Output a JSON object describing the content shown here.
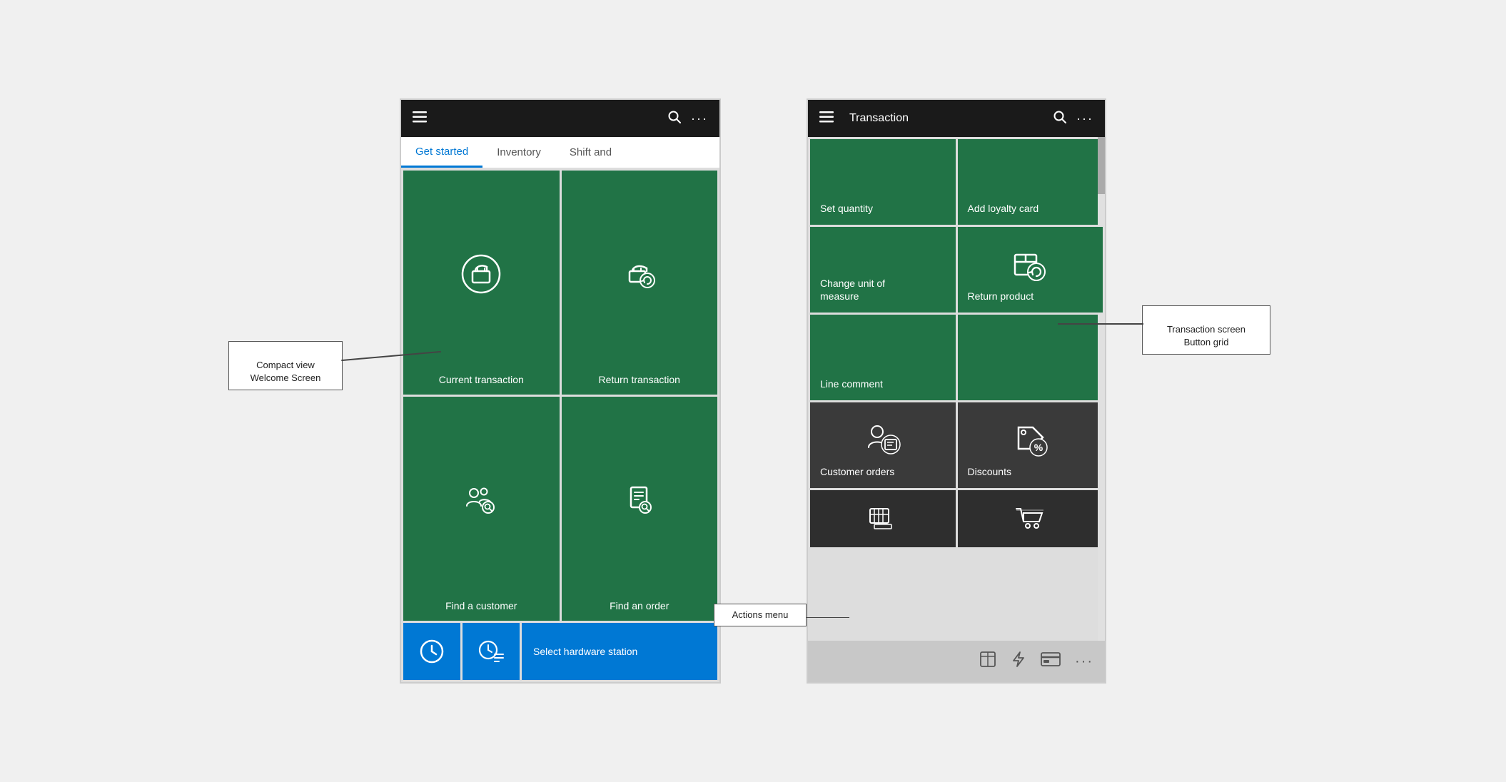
{
  "screens": {
    "left": {
      "nav": {
        "title": "",
        "search_icon": "🔍",
        "more_icon": "···",
        "hamburger": "☰"
      },
      "tabs": [
        {
          "label": "Get started",
          "active": true
        },
        {
          "label": "Inventory",
          "active": false
        },
        {
          "label": "Shift and",
          "active": false,
          "partial": true
        }
      ],
      "buttons": [
        {
          "id": "current-transaction",
          "label": "Current transaction",
          "color": "green",
          "icon": "bag"
        },
        {
          "id": "return-transaction",
          "label": "Return transaction",
          "color": "green",
          "icon": "bag-return"
        },
        {
          "id": "find-customer",
          "label": "Find a customer",
          "color": "green",
          "icon": "customer-search"
        },
        {
          "id": "find-order",
          "label": "Find an order",
          "color": "green",
          "icon": "order-search"
        }
      ],
      "bottom_buttons": [
        {
          "id": "clock1",
          "icon": "clock",
          "color": "blue"
        },
        {
          "id": "clock2",
          "icon": "clock-list",
          "color": "blue"
        },
        {
          "id": "hardware",
          "label": "Select hardware station",
          "color": "blue"
        }
      ]
    },
    "right": {
      "nav": {
        "title": "Transaction",
        "hamburger": "☰",
        "search_icon": "🔍",
        "more_icon": "···"
      },
      "buttons": [
        {
          "id": "set-quantity",
          "label": "Set quantity",
          "color": "green",
          "icon": ""
        },
        {
          "id": "add-loyalty",
          "label": "Add loyalty card",
          "color": "green",
          "icon": ""
        },
        {
          "id": "change-uom",
          "label": "Change unit of\nmeasure",
          "color": "green",
          "icon": ""
        },
        {
          "id": "return-product",
          "label": "Return product",
          "color": "green",
          "icon": "return-product"
        },
        {
          "id": "line-comment",
          "label": "Line comment",
          "color": "green",
          "icon": ""
        },
        {
          "id": "customer-orders",
          "label": "Customer orders",
          "color": "dark",
          "icon": "customer-orders"
        },
        {
          "id": "discounts",
          "label": "Discounts",
          "color": "dark",
          "icon": "discounts"
        },
        {
          "id": "partial1",
          "label": "",
          "color": "darker",
          "icon": "register"
        },
        {
          "id": "partial2",
          "label": "",
          "color": "darker",
          "icon": "cart"
        }
      ],
      "action_bar": [
        {
          "id": "calculator",
          "icon": "⊞"
        },
        {
          "id": "lightning",
          "icon": "⚡"
        },
        {
          "id": "dollar",
          "icon": "💵"
        },
        {
          "id": "more",
          "icon": "···"
        }
      ]
    }
  },
  "annotations": {
    "compact_view": "Compact view\nWelcome Screen",
    "return_transaction": "Return transaction",
    "find_customer": "Find a customer",
    "change_uom": "Change unit of measure",
    "transaction_button_grid": "Transaction screen\nButton grid",
    "select_hardware": "Select hardware station",
    "actions_menu": "Actions menu",
    "discounts": "Discounts"
  }
}
